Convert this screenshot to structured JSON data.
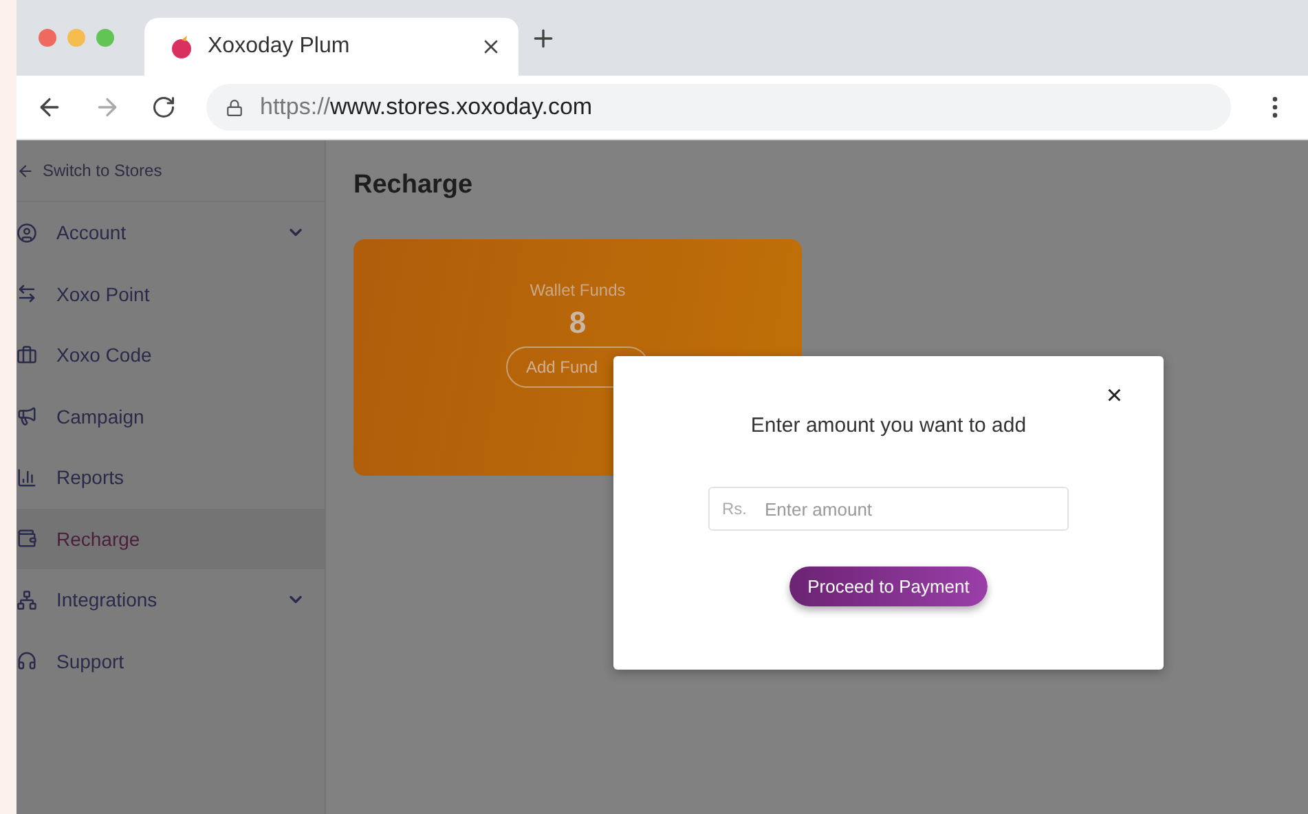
{
  "browser": {
    "tab_title": "Xoxoday Plum",
    "url_scheme": "https://",
    "url_host": "www.stores.xoxoday.com"
  },
  "sidebar": {
    "back_link": "Switch to Stores",
    "items": [
      {
        "label": "Account",
        "selected": false,
        "expandable": true
      },
      {
        "label": "Xoxo Point",
        "selected": false,
        "expandable": false
      },
      {
        "label": "Xoxo Code",
        "selected": false,
        "expandable": false
      },
      {
        "label": "Campaign",
        "selected": false,
        "expandable": false
      },
      {
        "label": "Reports",
        "selected": false,
        "expandable": false
      },
      {
        "label": "Recharge",
        "selected": true,
        "expandable": false
      },
      {
        "label": "Integrations",
        "selected": false,
        "expandable": true
      },
      {
        "label": "Support",
        "selected": false,
        "expandable": false
      }
    ]
  },
  "page": {
    "title": "Recharge",
    "wallet": {
      "label": "Wallet Funds",
      "amount": "8",
      "button": "Add Fund"
    }
  },
  "modal": {
    "title": "Enter amount you want to add",
    "close": "×",
    "currency": "Rs.",
    "placeholder": "Enter amount",
    "button": "Proceed to Payment"
  }
}
